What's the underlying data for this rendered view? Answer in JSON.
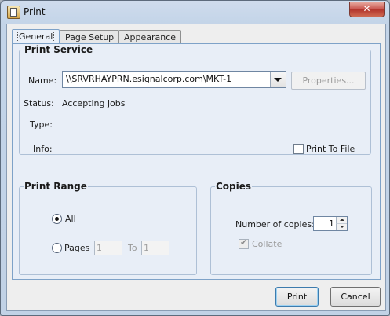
{
  "window": {
    "title": "Print",
    "close_glyph": "✕"
  },
  "tabs": [
    {
      "label": "General",
      "mnemonic_index": 0,
      "active": true
    },
    {
      "label": "Page Setup",
      "mnemonic_index": 5,
      "active": false
    },
    {
      "label": "Appearance",
      "mnemonic_index": 0,
      "active": false
    }
  ],
  "print_service": {
    "title": "Print Service",
    "name_label": "Name:",
    "name_value": "\\\\SRVRHAYPRN.esignalcorp.com\\MKT-1",
    "properties_button": "Properties...",
    "status_label": "Status:",
    "status_value": "Accepting jobs",
    "type_label": "Type:",
    "info_label": "Info:",
    "print_to_file_label": "Print To File",
    "print_to_file_checked": false
  },
  "print_range": {
    "title": "Print Range",
    "all_label": "All",
    "all_selected": true,
    "pages_label": "Pages",
    "pages_from": "1",
    "to_label": "To",
    "pages_to": "1"
  },
  "copies": {
    "title": "Copies",
    "number_label": "Number of copies:",
    "number_value": "1",
    "collate_label": "Collate",
    "collate_checked": true
  },
  "buttons": {
    "print": "Print",
    "cancel": "Cancel"
  },
  "colors": {
    "window_frame": "#c3d4e8",
    "close_button": "#c7504a",
    "panel_bg": "#e8eef7",
    "group_border": "#aec0d6"
  }
}
